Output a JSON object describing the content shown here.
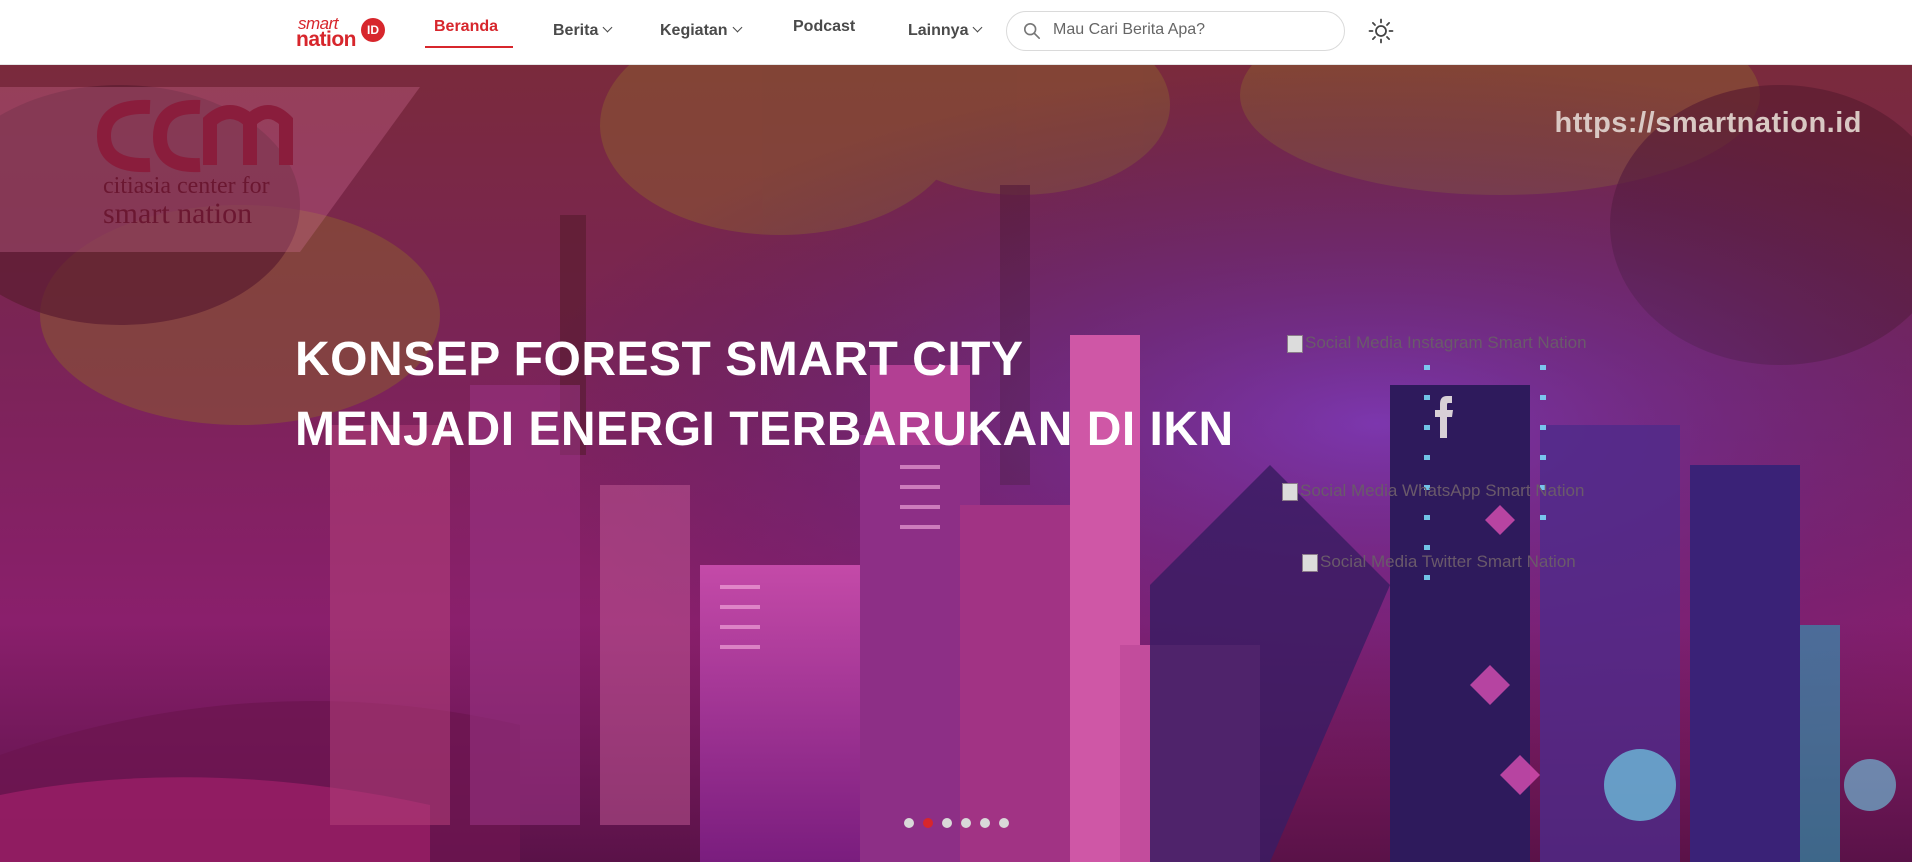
{
  "logo": {
    "smart": "smart",
    "nation": "nation",
    "badge": "ID"
  },
  "nav": {
    "home": "Beranda",
    "news": "Berita",
    "activities": "Kegiatan",
    "podcast": "Podcast",
    "more": "Lainnya"
  },
  "search": {
    "placeholder": "Mau Cari Berita Apa?"
  },
  "hero": {
    "url": "https://smartnation.id",
    "logo_line1": "citiasia center for",
    "logo_line2": "smart nation",
    "headline_line1": "KONSEP FOREST SMART CITY",
    "headline_line2": "MENJADI ENERGI TERBARUKAN DI IKN",
    "social_instagram_alt": "Social Media Instagram Smart Nation",
    "social_whatsapp_alt": "Social Media WhatsApp Smart Nation",
    "social_twitter_alt": "Social Media Twitter Smart Nation"
  },
  "carousel": {
    "slide_count": 6,
    "active_index": 1
  },
  "colors": {
    "brand_red": "#d7262c",
    "nav_text": "#4a4a4a"
  }
}
